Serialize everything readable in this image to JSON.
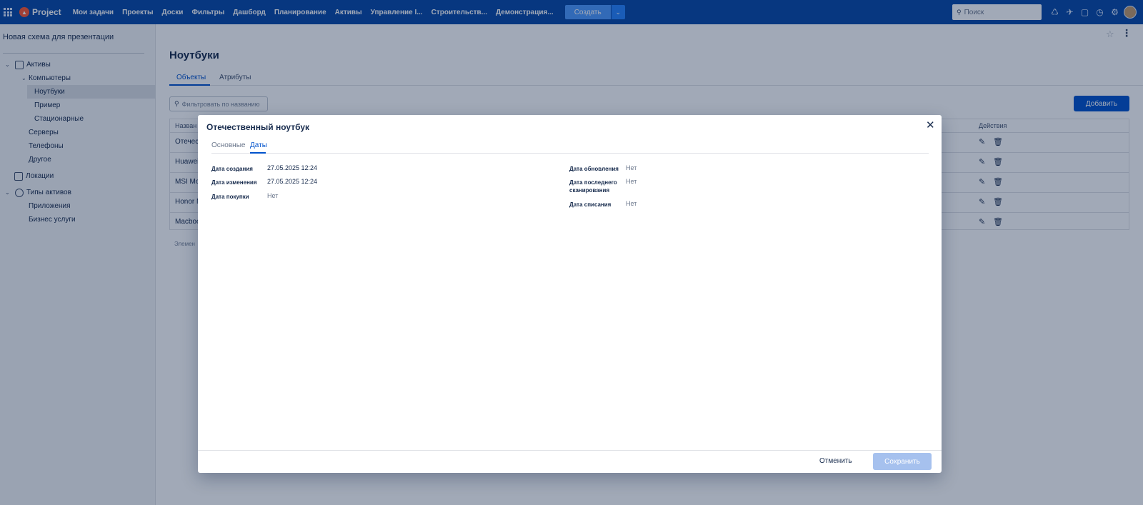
{
  "topbar": {
    "logo_text": "Project",
    "nav": [
      "Мои задачи",
      "Проекты",
      "Доски",
      "Фильтры",
      "Дашборд",
      "Планирование",
      "Активы",
      "Управление I...",
      "Строительств...",
      "Демонстрация..."
    ],
    "create_label": "Создать",
    "search_placeholder": "Поиск",
    "icons": [
      "notifications-icon",
      "releases-icon",
      "notes-icon",
      "history-icon",
      "settings-icon"
    ],
    "accent_color": "#0747a6"
  },
  "sidebar": {
    "project_name": "Новая схема для презентации",
    "tree": [
      {
        "label": "Активы",
        "icon": "assets-icon",
        "expanded": true
      },
      {
        "label": "Компьютеры",
        "expanded": true
      },
      {
        "label": "Ноутбуки",
        "selected": true
      },
      {
        "label": "Пример"
      },
      {
        "label": "Стационарные"
      },
      {
        "label": "Серверы"
      },
      {
        "label": "Телефоны"
      },
      {
        "label": "Другое"
      },
      {
        "label": "Локации",
        "icon": "locations-icon"
      },
      {
        "label": "Типы активов",
        "icon": "asset-types-icon",
        "expanded": true
      },
      {
        "label": "Приложения"
      },
      {
        "label": "Бизнес услуги"
      }
    ]
  },
  "main": {
    "title": "Ноутбуки",
    "tabs": [
      "Объекты",
      "Атрибуты"
    ],
    "filter_placeholder": "Фильтровать по названию",
    "add_label": "Добавить",
    "table": {
      "headers": [
        "Назван",
        "Действия"
      ],
      "rows": [
        "Отечест",
        "Huawei I",
        "MSI Moc",
        "Honor M",
        "Macboo"
      ]
    },
    "footer_note": "Элемен"
  },
  "modal": {
    "title": "Отечественный ноутбук",
    "tabs": [
      "Основные",
      "Даты"
    ],
    "fields_left": [
      {
        "label": "Дата создания",
        "value": "27.05.2025 12:24"
      },
      {
        "label": "Дата изменения",
        "value": "27.05.2025 12:24"
      },
      {
        "label": "Дата покупки",
        "value": "Нет"
      }
    ],
    "fields_right": [
      {
        "label": "Дата обновления",
        "value": "Нет"
      },
      {
        "label_line1": "Дата последнего",
        "label_line2": "сканирования",
        "value": "Нет"
      },
      {
        "label": "Дата списания",
        "value": "Нет"
      }
    ],
    "cancel_label": "Отменить",
    "save_label": "Сохранить"
  }
}
